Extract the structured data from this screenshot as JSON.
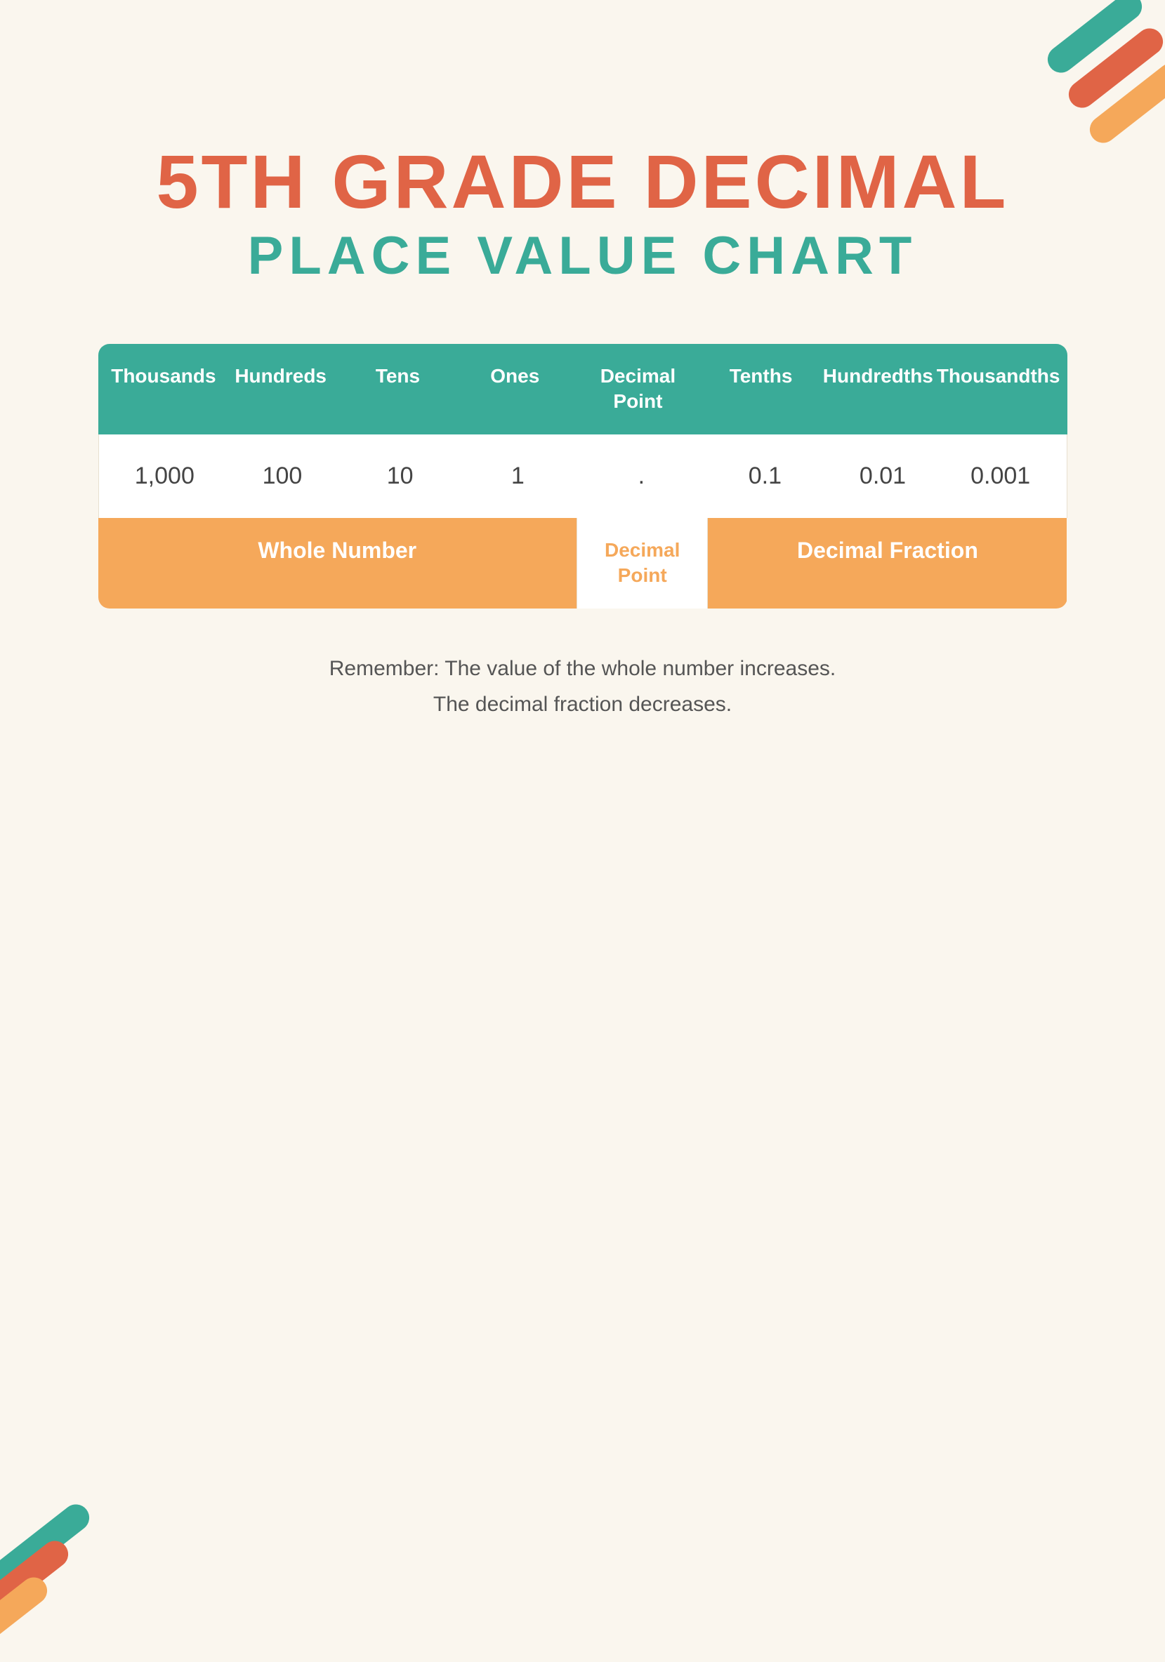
{
  "page": {
    "background_color": "#faf6ee"
  },
  "title": {
    "line1": "5TH GRADE DECIMAL",
    "line2": "PLACE VALUE CHART"
  },
  "table": {
    "headers": [
      {
        "id": "thousands",
        "label": "Thousands"
      },
      {
        "id": "hundreds",
        "label": "Hundreds"
      },
      {
        "id": "tens",
        "label": "Tens"
      },
      {
        "id": "ones",
        "label": "Ones"
      },
      {
        "id": "decimal-point",
        "label": "Decimal\nPoint"
      },
      {
        "id": "tenths",
        "label": "Tenths"
      },
      {
        "id": "hundredths",
        "label": "Hundredths"
      },
      {
        "id": "thousandths",
        "label": "Thousandths"
      }
    ],
    "values": [
      "1,000",
      "100",
      "10",
      "1",
      ".",
      "0.1",
      "0.01",
      "0.001"
    ],
    "labels": {
      "whole_number": "Whole Number",
      "decimal_point": "Decimal\nPoint",
      "decimal_fraction": "Decimal Fraction"
    }
  },
  "note": {
    "line1": "Remember: The value of the whole number increases.",
    "line2": "The decimal fraction decreases."
  },
  "colors": {
    "teal": "#3aab98",
    "coral": "#e06446",
    "orange": "#f5a85a",
    "white": "#ffffff",
    "background": "#faf6ee"
  }
}
